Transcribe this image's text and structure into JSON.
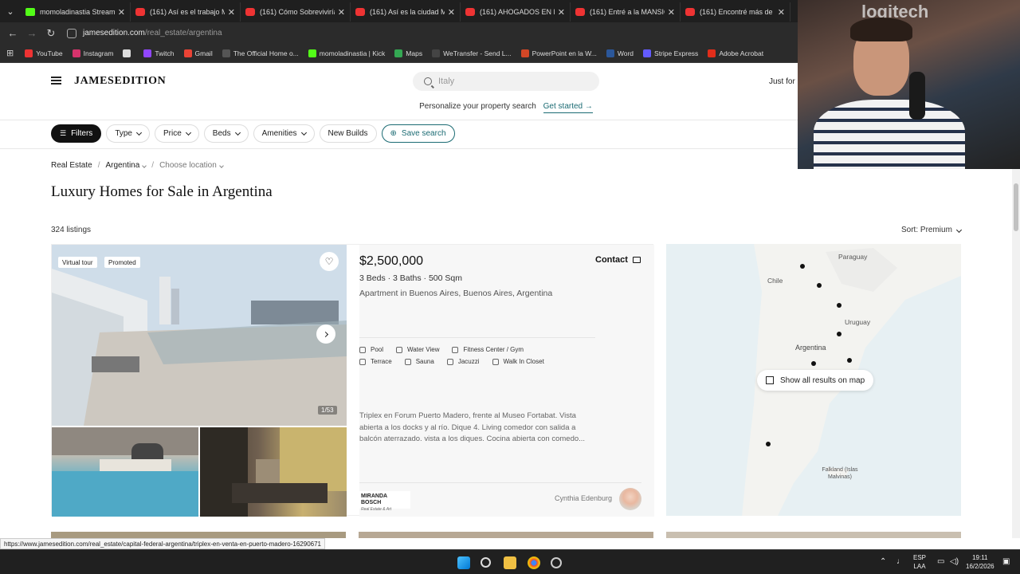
{
  "browser": {
    "tabs": [
      {
        "title": "momoladinastia Stream -",
        "icon": "kick"
      },
      {
        "title": "(161) Así es el trabajo MÁ",
        "icon": "youtube"
      },
      {
        "title": "(161) Cómo Sobreviviría Je",
        "icon": "youtube"
      },
      {
        "title": "(161) Así es la ciudad MÁ",
        "icon": "youtube"
      },
      {
        "title": "(161) AHOGADOS EN LA",
        "icon": "youtube"
      },
      {
        "title": "(161) Entré a la MANSIÓN",
        "icon": "youtube"
      },
      {
        "title": "(161) Encontré más de 10",
        "icon": "youtube"
      }
    ],
    "url_domain": "jamesedition.com",
    "url_path": "/real_estate/argentina",
    "bookmarks": [
      {
        "label": "YouTube",
        "color": "#e33"
      },
      {
        "label": "Instagram",
        "color": "#d6336c"
      },
      {
        "label": "",
        "color": "#ddd"
      },
      {
        "label": "Twitch",
        "color": "#9146ff"
      },
      {
        "label": "Gmail",
        "color": "#ea4335"
      },
      {
        "label": "The Official Home o...",
        "color": "#1a1a1a"
      },
      {
        "label": "momoladinastia | Kick",
        "color": "#53fc18"
      },
      {
        "label": "Maps",
        "color": "#34a853"
      },
      {
        "label": "WeTransfer - Send L...",
        "color": "#333"
      },
      {
        "label": "PowerPoint en la W...",
        "color": "#d24726"
      },
      {
        "label": "Word",
        "color": "#2b579a"
      },
      {
        "label": "Stripe Express",
        "color": "#635bff"
      },
      {
        "label": "Adobe Acrobat",
        "color": "#e12d1a"
      }
    ],
    "status_url": "https://www.jamesedition.com/real_estate/capital-federal-argentina/triplex-en-venta-en-puerto-madero-16290671"
  },
  "header": {
    "logo": "JAMESEDITION",
    "search_placeholder": "Italy",
    "just_for": "Just for",
    "personalize_text": "Personalize your property search",
    "get_started": "Get started →"
  },
  "filters": {
    "filters_label": "Filters",
    "type_label": "Type",
    "price_label": "Price",
    "beds_label": "Beds",
    "amenities_label": "Amenities",
    "new_builds_label": "New Builds",
    "save_search_label": "Save search"
  },
  "breadcrumb": {
    "root": "Real Estate",
    "separator": "/",
    "country": "Argentina",
    "location": "Choose location"
  },
  "page_title": "Luxury Homes for Sale in Argentina",
  "listing_count": "324 listings",
  "sort": {
    "label": "Sort:",
    "value": "Premium"
  },
  "listing": {
    "badges": [
      "Virtual tour",
      "Promoted"
    ],
    "photo_counter": "1/53",
    "price": "$2,500,000",
    "contact_label": "Contact",
    "specs": "3 Beds · 3 Baths · 500 Sqm",
    "property_type": "Apartment in Buenos Aires, Buenos Aires, Argentina",
    "amenities_row1": [
      "Pool",
      "Water View",
      "Fitness Center / Gym"
    ],
    "amenities_row2": [
      "Terrace",
      "Sauna",
      "Jacuzzi",
      "Walk In Closet"
    ],
    "description": "Triplex en Forum Puerto Madero, frente al Museo Fortabat. Vista abierta a los docks y al río. Dique 4. Living comedor con salida a balcón aterrazado. vista a los diques. Cocina abierta con comedo...",
    "agency_name": "MIRANDA BOSCH",
    "agency_sub": "Real Estate & Art",
    "agent_name": "Cynthia Edenburg"
  },
  "map": {
    "labels": [
      "Paraguay",
      "Chile",
      "Uruguay",
      "Argentina",
      "Falkland (Islas Malvinas)"
    ],
    "show_all_label": "Show all results on map"
  },
  "taskbar": {
    "lang_top": "ESP",
    "lang_bottom": "LAA",
    "time": "19:11",
    "date": "16/2/2026"
  },
  "webcam": {
    "brand_text": "logitech"
  }
}
